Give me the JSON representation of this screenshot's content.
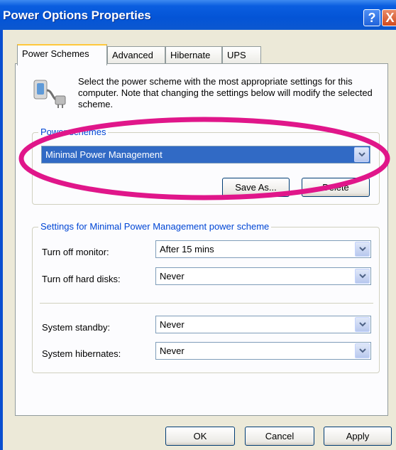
{
  "window": {
    "title": "Power Options Properties",
    "help_glyph": "?",
    "close_glyph": "X"
  },
  "tabs": [
    {
      "label": "Power Schemes",
      "active": true
    },
    {
      "label": "Advanced",
      "active": false
    },
    {
      "label": "Hibernate",
      "active": false
    },
    {
      "label": "UPS",
      "active": false
    }
  ],
  "description": "Select the power scheme with the most appropriate settings for this computer. Note that changing the settings below will modify the selected scheme.",
  "power_schemes": {
    "group_title": "Power schemes",
    "selected": "Minimal Power Management",
    "save_as_label": "Save As...",
    "delete_label": "Delete"
  },
  "settings": {
    "group_title": "Settings for Minimal Power Management power scheme",
    "rows": [
      {
        "label": "Turn off monitor:",
        "value": "After 15 mins"
      },
      {
        "label": "Turn off hard disks:",
        "value": "Never"
      },
      {
        "label": "System standby:",
        "value": "Never"
      },
      {
        "label": "System hibernates:",
        "value": "Never"
      }
    ]
  },
  "footer": {
    "ok_label": "OK",
    "cancel_label": "Cancel",
    "apply_label": "Apply"
  },
  "colors": {
    "titlebar": "#0454d6",
    "highlight": "#316ac5",
    "annotation": "#e0168a"
  },
  "icons": [
    "help-icon",
    "close-icon",
    "power-plug-icon",
    "dropdown-arrow-icon"
  ]
}
